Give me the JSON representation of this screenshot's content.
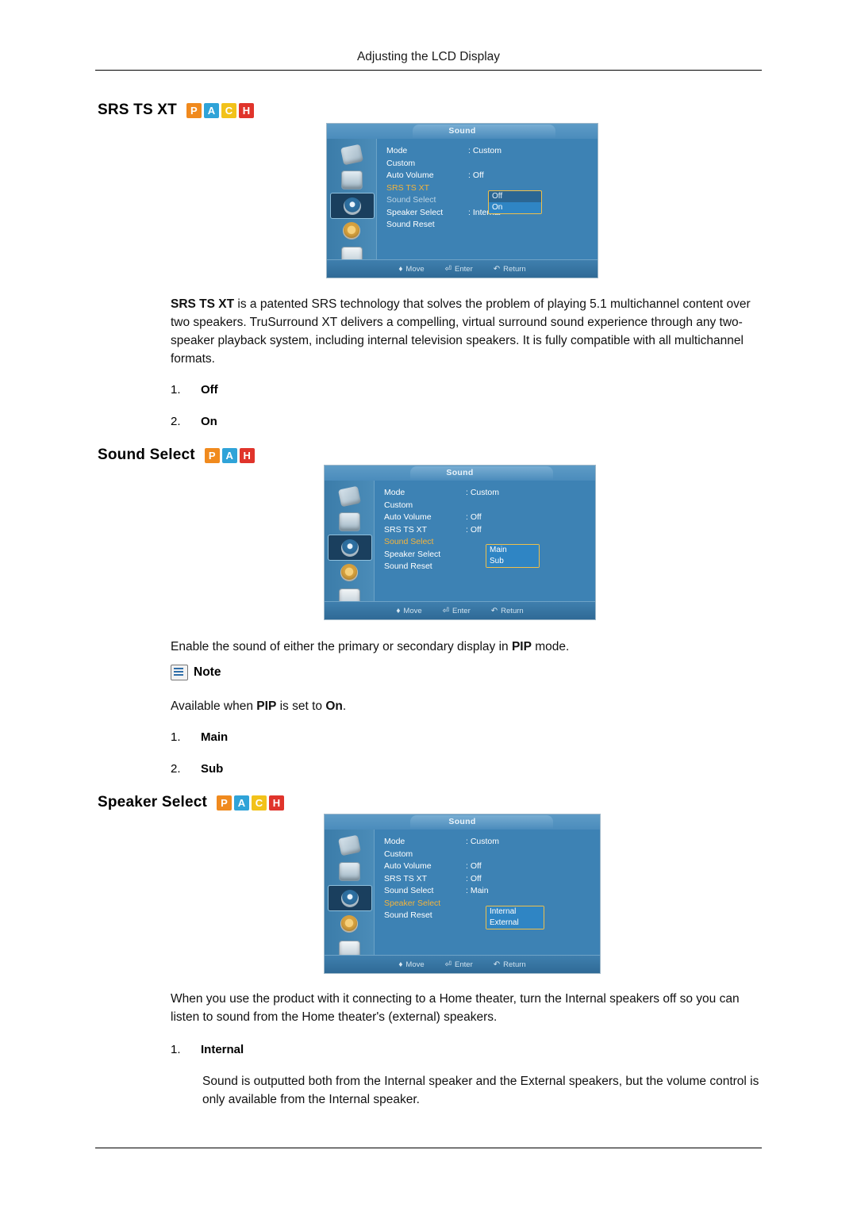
{
  "header": {
    "title": "Adjusting the LCD Display"
  },
  "sections": [
    {
      "heading": "SRS TS XT",
      "badges": [
        "P",
        "A",
        "C",
        "H"
      ],
      "osd": {
        "title": "Sound",
        "rows": [
          {
            "label": "Mode",
            "value": ": Custom",
            "state": "normal"
          },
          {
            "label": "Custom",
            "value": "",
            "state": "normal"
          },
          {
            "label": "Auto Volume",
            "value": ": Off",
            "state": "normal"
          },
          {
            "label": "SRS TS XT",
            "value": "",
            "state": "active"
          },
          {
            "label": "Sound Select",
            "value": "",
            "state": "dim"
          },
          {
            "label": "Speaker Select",
            "value": ": Internal",
            "state": "normal"
          },
          {
            "label": "Sound Reset",
            "value": "",
            "state": "normal"
          }
        ],
        "popup": {
          "options": [
            "Off",
            "On"
          ],
          "selected": "On"
        },
        "footer": [
          {
            "glyph": "♦",
            "label": "Move"
          },
          {
            "glyph": "⏎",
            "label": "Enter"
          },
          {
            "glyph": "↶",
            "label": "Return"
          }
        ]
      },
      "body": "<b>SRS TS XT</b> is a patented SRS technology that solves the problem of playing 5.1 multichannel content over two speakers. TruSurround XT delivers a compelling, virtual surround sound experience through any two-speaker playback system, including internal television speakers. It is fully compatible with all multichannel formats.",
      "options": [
        {
          "num": "1.",
          "text": "Off"
        },
        {
          "num": "2.",
          "text": "On"
        }
      ]
    },
    {
      "heading": "Sound Select",
      "badges": [
        "P",
        "A",
        "H"
      ],
      "osd": {
        "title": "Sound",
        "rows": [
          {
            "label": "Mode",
            "value": ": Custom",
            "state": "normal"
          },
          {
            "label": "Custom",
            "value": "",
            "state": "normal"
          },
          {
            "label": "Auto Volume",
            "value": ": Off",
            "state": "normal"
          },
          {
            "label": "SRS TS XT",
            "value": ": Off",
            "state": "normal"
          },
          {
            "label": "Sound Select",
            "value": "",
            "state": "active"
          },
          {
            "label": "Speaker Select",
            "value": "",
            "state": "normal"
          },
          {
            "label": "Sound Reset",
            "value": "",
            "state": "normal"
          }
        ],
        "popup": {
          "options": [
            "Main",
            "Sub"
          ],
          "selected": "Main"
        },
        "footer": [
          {
            "glyph": "♦",
            "label": "Move"
          },
          {
            "glyph": "⏎",
            "label": "Enter"
          },
          {
            "glyph": "↶",
            "label": "Return"
          }
        ]
      },
      "body": "Enable the sound of either the primary or secondary display in <b>PIP</b> mode.",
      "note": {
        "label": "Note",
        "text": "Available when <b>PIP</b> is set to <b>On</b>."
      },
      "options": [
        {
          "num": "1.",
          "text": "Main"
        },
        {
          "num": "2.",
          "text": "Sub"
        }
      ]
    },
    {
      "heading": "Speaker Select",
      "badges": [
        "P",
        "A",
        "C",
        "H"
      ],
      "osd": {
        "title": "Sound",
        "rows": [
          {
            "label": "Mode",
            "value": ": Custom",
            "state": "normal"
          },
          {
            "label": "Custom",
            "value": "",
            "state": "normal"
          },
          {
            "label": "Auto Volume",
            "value": ": Off",
            "state": "normal"
          },
          {
            "label": "SRS TS XT",
            "value": ": Off",
            "state": "normal"
          },
          {
            "label": "Sound Select",
            "value": ": Main",
            "state": "normal"
          },
          {
            "label": "Speaker Select",
            "value": "",
            "state": "active"
          },
          {
            "label": "Sound Reset",
            "value": "",
            "state": "normal"
          }
        ],
        "popup": {
          "options": [
            "Internal",
            "External"
          ],
          "selected": "Internal"
        },
        "footer": [
          {
            "glyph": "♦",
            "label": "Move"
          },
          {
            "glyph": "⏎",
            "label": "Enter"
          },
          {
            "glyph": "↶",
            "label": "Return"
          }
        ]
      },
      "body": "When you use the product with it connecting to a Home theater, turn the Internal speakers off so you can listen to sound from the Home theater's (external) speakers.",
      "options": [
        {
          "num": "1.",
          "text": "Internal"
        }
      ],
      "sub_body": "Sound is outputted both from the Internal speaker and the External speakers, but the volume control is only available from the Internal speaker."
    }
  ],
  "colors": {
    "badge_p": "#f08a1e",
    "badge_a": "#2fa3d8",
    "badge_c": "#f2c21a",
    "badge_h": "#e0342b",
    "osd_bg": "#3d82b4",
    "osd_highlight": "#f4b43c"
  }
}
